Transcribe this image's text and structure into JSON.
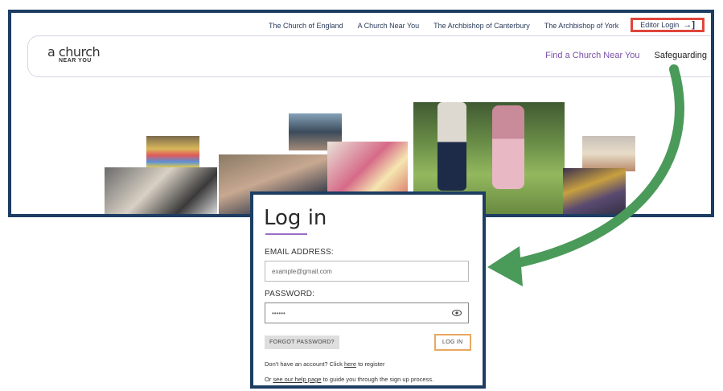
{
  "topnav": {
    "links": [
      "The Church of England",
      "A Church Near You",
      "The Archbishop of Canterbury",
      "The Archbishop of York"
    ],
    "editor_login": "Editor Login"
  },
  "header": {
    "logo_line1": "a church",
    "logo_line2": "NEAR YOU",
    "find_link": "Find a Church Near You",
    "safeguarding_link": "Safeguarding"
  },
  "login": {
    "title": "Log in",
    "email_label": "EMAIL ADDRESS:",
    "email_value": "example@gmail.com",
    "password_label": "PASSWORD:",
    "password_value": "••••••",
    "forgot_label": "FORGOT PASSWORD?",
    "login_label": "LOG IN",
    "note1_pre": "Don't have an account? Click ",
    "note1_link": "here",
    "note1_post": " to register",
    "note2_pre": "Or ",
    "note2_link": "see our help page",
    "note2_post": " to guide you through the sign up process."
  },
  "colors": {
    "frame": "#1d3d63",
    "highlight": "#e0453b",
    "arrow": "#4a9a5a",
    "accent": "#7b4fa6"
  },
  "icons": [
    "arrow-right-to-bracket-icon",
    "eye-icon",
    "curved-arrow-icon"
  ]
}
